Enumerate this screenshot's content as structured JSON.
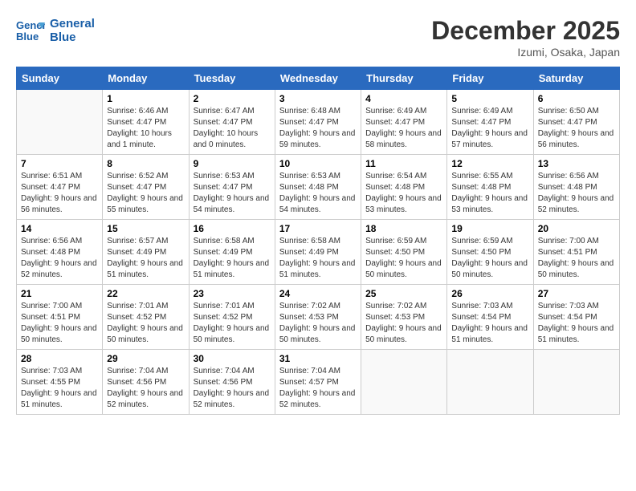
{
  "header": {
    "logo_line1": "General",
    "logo_line2": "Blue",
    "month": "December 2025",
    "location": "Izumi, Osaka, Japan"
  },
  "weekdays": [
    "Sunday",
    "Monday",
    "Tuesday",
    "Wednesday",
    "Thursday",
    "Friday",
    "Saturday"
  ],
  "weeks": [
    [
      {
        "day": "",
        "empty": true
      },
      {
        "day": "1",
        "sunrise": "6:46 AM",
        "sunset": "4:47 PM",
        "daylight": "10 hours and 1 minute."
      },
      {
        "day": "2",
        "sunrise": "6:47 AM",
        "sunset": "4:47 PM",
        "daylight": "10 hours and 0 minutes."
      },
      {
        "day": "3",
        "sunrise": "6:48 AM",
        "sunset": "4:47 PM",
        "daylight": "9 hours and 59 minutes."
      },
      {
        "day": "4",
        "sunrise": "6:49 AM",
        "sunset": "4:47 PM",
        "daylight": "9 hours and 58 minutes."
      },
      {
        "day": "5",
        "sunrise": "6:49 AM",
        "sunset": "4:47 PM",
        "daylight": "9 hours and 57 minutes."
      },
      {
        "day": "6",
        "sunrise": "6:50 AM",
        "sunset": "4:47 PM",
        "daylight": "9 hours and 56 minutes."
      }
    ],
    [
      {
        "day": "7",
        "sunrise": "6:51 AM",
        "sunset": "4:47 PM",
        "daylight": "9 hours and 56 minutes."
      },
      {
        "day": "8",
        "sunrise": "6:52 AM",
        "sunset": "4:47 PM",
        "daylight": "9 hours and 55 minutes."
      },
      {
        "day": "9",
        "sunrise": "6:53 AM",
        "sunset": "4:47 PM",
        "daylight": "9 hours and 54 minutes."
      },
      {
        "day": "10",
        "sunrise": "6:53 AM",
        "sunset": "4:48 PM",
        "daylight": "9 hours and 54 minutes."
      },
      {
        "day": "11",
        "sunrise": "6:54 AM",
        "sunset": "4:48 PM",
        "daylight": "9 hours and 53 minutes."
      },
      {
        "day": "12",
        "sunrise": "6:55 AM",
        "sunset": "4:48 PM",
        "daylight": "9 hours and 53 minutes."
      },
      {
        "day": "13",
        "sunrise": "6:56 AM",
        "sunset": "4:48 PM",
        "daylight": "9 hours and 52 minutes."
      }
    ],
    [
      {
        "day": "14",
        "sunrise": "6:56 AM",
        "sunset": "4:48 PM",
        "daylight": "9 hours and 52 minutes."
      },
      {
        "day": "15",
        "sunrise": "6:57 AM",
        "sunset": "4:49 PM",
        "daylight": "9 hours and 51 minutes."
      },
      {
        "day": "16",
        "sunrise": "6:58 AM",
        "sunset": "4:49 PM",
        "daylight": "9 hours and 51 minutes."
      },
      {
        "day": "17",
        "sunrise": "6:58 AM",
        "sunset": "4:49 PM",
        "daylight": "9 hours and 51 minutes."
      },
      {
        "day": "18",
        "sunrise": "6:59 AM",
        "sunset": "4:50 PM",
        "daylight": "9 hours and 50 minutes."
      },
      {
        "day": "19",
        "sunrise": "6:59 AM",
        "sunset": "4:50 PM",
        "daylight": "9 hours and 50 minutes."
      },
      {
        "day": "20",
        "sunrise": "7:00 AM",
        "sunset": "4:51 PM",
        "daylight": "9 hours and 50 minutes."
      }
    ],
    [
      {
        "day": "21",
        "sunrise": "7:00 AM",
        "sunset": "4:51 PM",
        "daylight": "9 hours and 50 minutes."
      },
      {
        "day": "22",
        "sunrise": "7:01 AM",
        "sunset": "4:52 PM",
        "daylight": "9 hours and 50 minutes."
      },
      {
        "day": "23",
        "sunrise": "7:01 AM",
        "sunset": "4:52 PM",
        "daylight": "9 hours and 50 minutes."
      },
      {
        "day": "24",
        "sunrise": "7:02 AM",
        "sunset": "4:53 PM",
        "daylight": "9 hours and 50 minutes."
      },
      {
        "day": "25",
        "sunrise": "7:02 AM",
        "sunset": "4:53 PM",
        "daylight": "9 hours and 50 minutes."
      },
      {
        "day": "26",
        "sunrise": "7:03 AM",
        "sunset": "4:54 PM",
        "daylight": "9 hours and 51 minutes."
      },
      {
        "day": "27",
        "sunrise": "7:03 AM",
        "sunset": "4:54 PM",
        "daylight": "9 hours and 51 minutes."
      }
    ],
    [
      {
        "day": "28",
        "sunrise": "7:03 AM",
        "sunset": "4:55 PM",
        "daylight": "9 hours and 51 minutes."
      },
      {
        "day": "29",
        "sunrise": "7:04 AM",
        "sunset": "4:56 PM",
        "daylight": "9 hours and 52 minutes."
      },
      {
        "day": "30",
        "sunrise": "7:04 AM",
        "sunset": "4:56 PM",
        "daylight": "9 hours and 52 minutes."
      },
      {
        "day": "31",
        "sunrise": "7:04 AM",
        "sunset": "4:57 PM",
        "daylight": "9 hours and 52 minutes."
      },
      {
        "day": "",
        "empty": true
      },
      {
        "day": "",
        "empty": true
      },
      {
        "day": "",
        "empty": true
      }
    ]
  ],
  "labels": {
    "sunrise": "Sunrise:",
    "sunset": "Sunset:",
    "daylight": "Daylight hours"
  }
}
